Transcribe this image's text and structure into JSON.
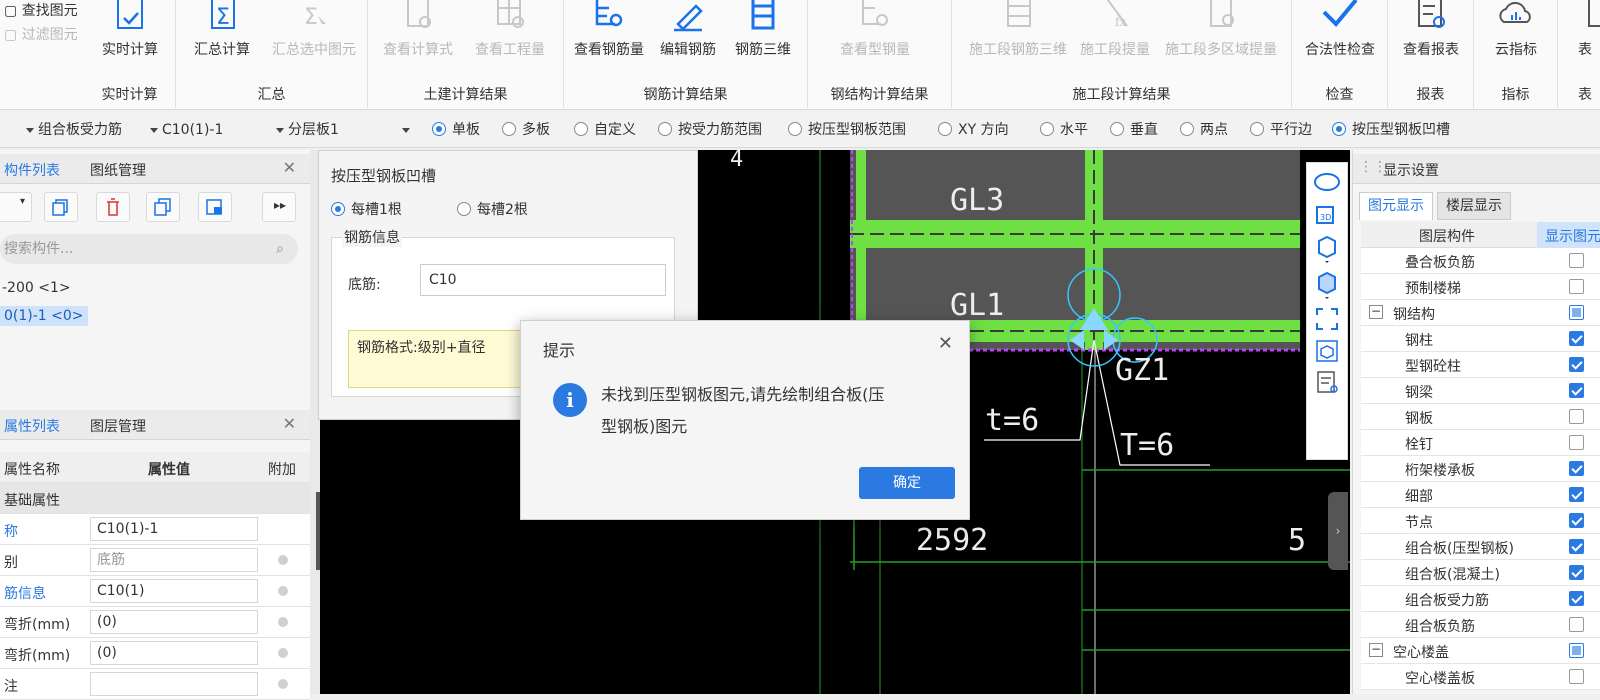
{
  "ribbon": {
    "small": [
      "查找图元",
      "过滤图元"
    ],
    "groups": [
      {
        "label": "实时计算",
        "buttons": [
          "实时计算"
        ]
      },
      {
        "label": "汇总",
        "buttons": [
          "汇总计算",
          "汇总选中图元"
        ]
      },
      {
        "label": "土建计算结果",
        "buttons": [
          "查看计算式",
          "查看工程量"
        ]
      },
      {
        "label": "钢筋计算结果",
        "buttons": [
          "查看钢筋量",
          "编辑钢筋",
          "钢筋三维"
        ]
      },
      {
        "label": "钢结构计算结果",
        "buttons": [
          "查看型钢量"
        ]
      },
      {
        "label": "施工段计算结果",
        "buttons": [
          "施工段钢筋三维",
          "施工段提量",
          "施工段多区域提量"
        ]
      },
      {
        "label": "检查",
        "buttons": [
          "合法性检查"
        ]
      },
      {
        "label": "报表",
        "buttons": [
          "查看报表"
        ]
      },
      {
        "label": "指标",
        "buttons": [
          "云指标"
        ]
      },
      {
        "label": "表",
        "buttons": [
          "表"
        ]
      }
    ]
  },
  "toolbar": {
    "type_select": "组合板受力筋",
    "name_select": "C10(1)-1",
    "layer_select": "分层板1",
    "radios": [
      "单板",
      "多板",
      "自定义",
      "按受力筋范围",
      "按压型钢板范围",
      "XY 方向",
      "水平",
      "垂直",
      "两点",
      "平行边",
      "按压型钢板凹槽"
    ]
  },
  "left_panel": {
    "tabs": [
      "构件列表",
      "图纸管理"
    ],
    "search_placeholder": "搜索构件...",
    "tree": [
      "-200 <1>",
      "0(1)-1 <0>"
    ],
    "prop_tabs": [
      "属性列表",
      "图层管理"
    ],
    "prop_headers": [
      "属性名称",
      "属性值",
      "附加"
    ],
    "section": "基础属性",
    "props": [
      {
        "name": "称",
        "value": "C10(1)-1"
      },
      {
        "name": "别",
        "value": "底筋"
      },
      {
        "name": "筋信息",
        "value": "C10(1)"
      },
      {
        "name": "弯折(mm)",
        "value": "(0)"
      },
      {
        "name": "弯折(mm)",
        "value": "(0)"
      },
      {
        "name": "注",
        "value": ""
      }
    ]
  },
  "subdialog": {
    "title": "按压型钢板凹槽",
    "opt1": "每槽1根",
    "opt2": "每槽2根",
    "group": "钢筋信息",
    "field_label": "底筋:",
    "field_value": "C10",
    "hint": "钢筋格式:级别+直径"
  },
  "modal": {
    "title": "提示",
    "msg1": "未找到压型钢板图元,请先绘制组合板(压",
    "msg2": "型钢板)图元",
    "ok": "确定"
  },
  "canvas": {
    "labels": [
      "GL3",
      "GL1",
      "GZ1",
      "t=6",
      "T=6",
      "2592",
      "5",
      "4"
    ]
  },
  "right_panel": {
    "title": "显示设置",
    "tabs": [
      "图元显示",
      "楼层显示"
    ],
    "headers": [
      "图层构件",
      "显示图元"
    ],
    "rows": [
      {
        "name": "叠合板负筋",
        "state": "off",
        "lvl": 2
      },
      {
        "name": "预制楼梯",
        "state": "off",
        "lvl": 2
      },
      {
        "name": "钢结构",
        "state": "part",
        "lvl": 1
      },
      {
        "name": "钢柱",
        "state": "on",
        "lvl": 2
      },
      {
        "name": "型钢砼柱",
        "state": "on",
        "lvl": 2
      },
      {
        "name": "钢梁",
        "state": "on",
        "lvl": 2
      },
      {
        "name": "钢板",
        "state": "off",
        "lvl": 2
      },
      {
        "name": "栓钉",
        "state": "off",
        "lvl": 2
      },
      {
        "name": "桁架楼承板",
        "state": "on",
        "lvl": 2
      },
      {
        "name": "细部",
        "state": "on",
        "lvl": 2
      },
      {
        "name": "节点",
        "state": "on",
        "lvl": 2
      },
      {
        "name": "组合板(压型钢板)",
        "state": "on",
        "lvl": 2
      },
      {
        "name": "组合板(混凝土)",
        "state": "on",
        "lvl": 2
      },
      {
        "name": "组合板受力筋",
        "state": "on",
        "lvl": 2
      },
      {
        "name": "组合板负筋",
        "state": "off",
        "lvl": 2
      },
      {
        "name": "空心楼盖",
        "state": "part",
        "lvl": 1
      },
      {
        "name": "空心楼盖板",
        "state": "off",
        "lvl": 2
      }
    ]
  },
  "colors": {
    "accent": "#2a7ae2",
    "beam": "#7ee84a",
    "slab": "#555555"
  }
}
